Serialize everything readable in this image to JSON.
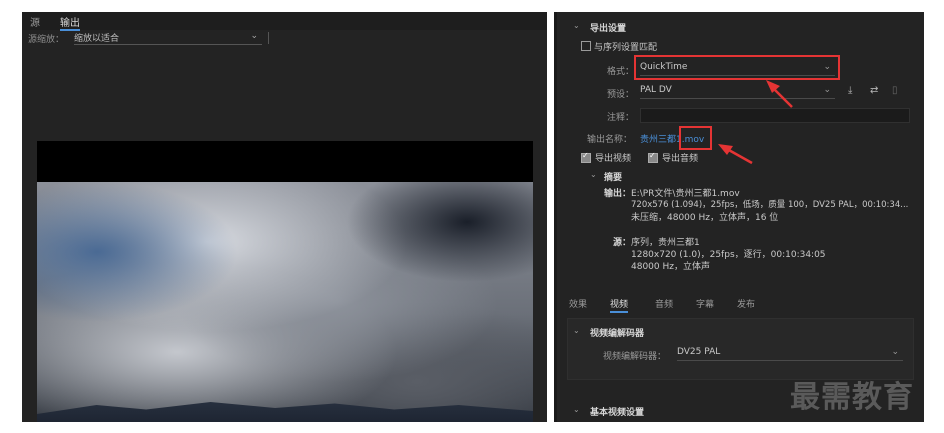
{
  "left_panel": {
    "tabs": [
      "源",
      "输出"
    ],
    "source_scale_label": "源缩放：",
    "source_scale_value": "缩放以适合"
  },
  "export_settings": {
    "section_title": "导出设置",
    "match_sequence_label": "与序列设置匹配",
    "format_label": "格式：",
    "format_value": "QuickTime",
    "preset_label": "预设：",
    "preset_value": "PAL DV",
    "comment_label": "注释：",
    "output_name_label": "输出名称：",
    "output_name_prefix": "贵州三都",
    "output_name_suffix": "1.mov",
    "export_video_label": "导出视频",
    "export_audio_label": "导出音频",
    "summary_title": "摘要",
    "output_label": "输出：",
    "output_line1": "E:\\PR文件\\贵州三都1.mov",
    "output_line2": "720x576 (1.094)，25fps，低场，质量 100，DV25 PAL，00:10:34...",
    "output_line3": "未压缩，48000 Hz，立体声，16 位",
    "source_label": "源：",
    "source_line1": "序列，贵州三都1",
    "source_line2": "1280x720 (1.0)，25fps，逐行，00:10:34:05",
    "source_line3": "48000 Hz，立体声"
  },
  "bottom_tabs": [
    "效果",
    "视频",
    "音频",
    "字幕",
    "发布"
  ],
  "video_codec": {
    "section_title": "视频编解码器",
    "codec_label": "视频编解码器：",
    "codec_value": "DV25 PAL"
  },
  "basic_video": {
    "section_title": "基本视频设置"
  },
  "watermark": "最需教育",
  "colors": {
    "accent": "#4a8fd8",
    "highlight": "#e53434",
    "panel_bg": "#232323"
  }
}
